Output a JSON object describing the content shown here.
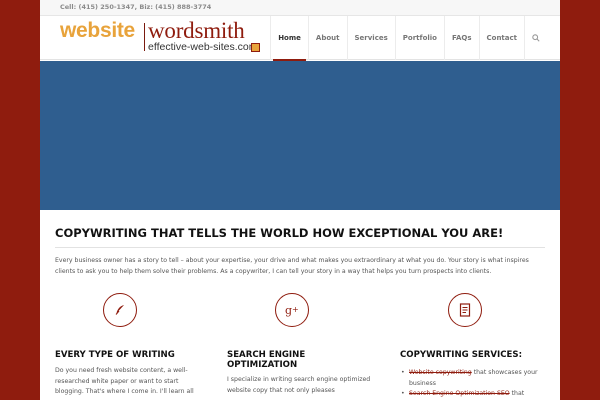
{
  "topbar": {
    "contact": "Cell: (415) 250-1347, Biz: (415) 888-3774"
  },
  "logo": {
    "part1": "website",
    "part2": "wordsmith",
    "domain": "effective-web-sites.com"
  },
  "nav": {
    "items": [
      "Home",
      "About",
      "Services",
      "Portfolio",
      "FAQs",
      "Contact"
    ],
    "active": "Home",
    "search_icon": "search-icon"
  },
  "colors": {
    "brand": "#8f1c0e",
    "accent": "#e8a33b",
    "hero": "#2f5e8f"
  },
  "main": {
    "headline": "COPYWRITING THAT TELLS THE WORLD HOW EXCEPTIONAL YOU ARE!",
    "intro": "Every business owner has a story to tell – about your expertise, your drive and what makes you extraordinary at what you do. Your story is what inspires clients to ask you to help them solve their problems. As a copywriter, I can tell your story in a way that helps you turn prospects into clients."
  },
  "features": [
    {
      "icon": "quill-icon",
      "title": "EVERY TYPE OF WRITING",
      "text": "Do you need fresh website content, a well-researched white paper or want to start blogging. That's where I come in. I'll learn all"
    },
    {
      "icon": "google-plus-icon",
      "title": "SEARCH ENGINE OPTIMIZATION",
      "text": "I specialize in writing search engine optimized website copy that not only pleases"
    },
    {
      "icon": "document-icon",
      "title": "COPYWRITING SERVICES:",
      "services": [
        {
          "link": "Website copywriting",
          "rest": " that showcases your business"
        },
        {
          "link": "Search Engine Optimization SEO",
          "rest": " that"
        }
      ]
    }
  ]
}
